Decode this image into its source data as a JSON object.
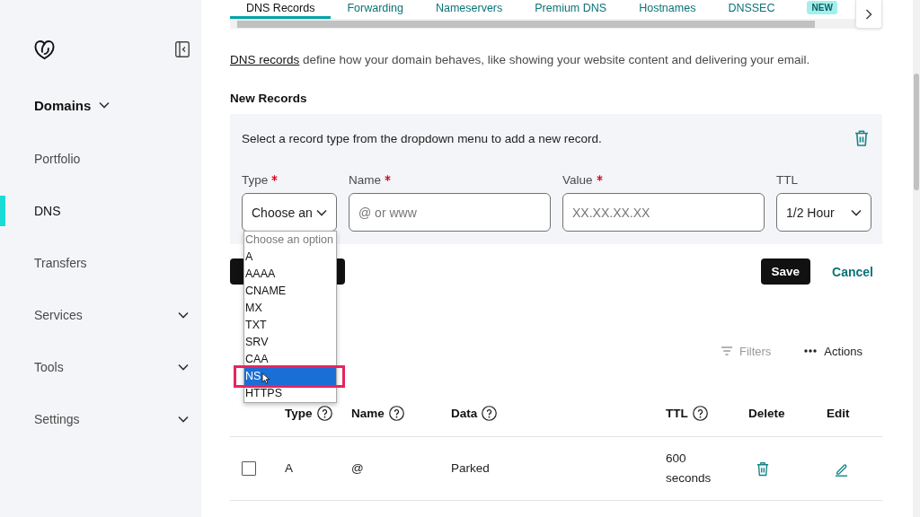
{
  "sidebar": {
    "section": {
      "label": "Domains"
    },
    "items": [
      {
        "label": "Portfolio",
        "kind": "link",
        "selected": false
      },
      {
        "label": "DNS",
        "kind": "link",
        "selected": true
      },
      {
        "label": "Transfers",
        "kind": "link",
        "selected": false
      },
      {
        "label": "Services",
        "kind": "group",
        "selected": false
      },
      {
        "label": "Tools",
        "kind": "group",
        "selected": false
      },
      {
        "label": "Settings",
        "kind": "group",
        "selected": false
      }
    ]
  },
  "tabs": [
    {
      "label": "DNS Records",
      "selected": true
    },
    {
      "label": "Forwarding",
      "selected": false
    },
    {
      "label": "Nameservers",
      "selected": false
    },
    {
      "label": "Premium DNS",
      "selected": false
    },
    {
      "label": "Hostnames",
      "selected": false
    },
    {
      "label": "DNSSEC",
      "selected": false
    },
    {
      "badge": "NEW",
      "selected": false
    }
  ],
  "intro": {
    "link": "DNS records",
    "text": "define how your domain behaves, like showing your website content and delivering your email."
  },
  "new_records": {
    "title": "New Records",
    "hint": "Select a record type from the dropdown menu to add a new record.",
    "fields": [
      {
        "kind": "select",
        "label": "Type",
        "required": true,
        "value": "Choose an",
        "menu": {
          "placeholder": "Choose an option",
          "options": [
            {
              "label": "A",
              "selected": false,
              "highlighted": false
            },
            {
              "label": "AAAA",
              "selected": false,
              "highlighted": false
            },
            {
              "label": "CNAME",
              "selected": false,
              "highlighted": false
            },
            {
              "label": "MX",
              "selected": false,
              "highlighted": false
            },
            {
              "label": "TXT",
              "selected": false,
              "highlighted": false
            },
            {
              "label": "SRV",
              "selected": false,
              "highlighted": false
            },
            {
              "label": "CAA",
              "selected": false,
              "highlighted": false
            },
            {
              "label": "NS",
              "selected": true,
              "highlighted": true
            },
            {
              "label": "HTTPS",
              "selected": false,
              "highlighted": false
            }
          ]
        }
      },
      {
        "kind": "input",
        "label": "Name",
        "required": true,
        "placeholder": "@ or www"
      },
      {
        "kind": "input",
        "label": "Value",
        "required": true,
        "placeholder": "XX.XX.XX.XX"
      },
      {
        "kind": "select",
        "label": "TTL",
        "required": false,
        "value": "1/2 Hour"
      }
    ],
    "buttons": [
      {
        "kind": "primary"
      },
      {
        "kind": "primary",
        "label": "Save"
      },
      {
        "kind": "link",
        "label": "Cancel"
      }
    ]
  },
  "toolbar": {
    "filters": {
      "label": "Filters",
      "disabled": true
    },
    "actions": {
      "label": "Actions"
    }
  },
  "table": {
    "columns": [
      {
        "label": "Type",
        "help": true,
        "kind": "text"
      },
      {
        "label": "Name",
        "help": true,
        "kind": "text"
      },
      {
        "label": "Data",
        "help": true,
        "kind": "text"
      },
      {
        "label": "TTL",
        "help": true,
        "kind": "text"
      },
      {
        "label": "Delete",
        "help": false,
        "kind": "delete"
      },
      {
        "label": "Edit",
        "help": false,
        "kind": "edit"
      }
    ],
    "rows": [
      {
        "checked": false,
        "cells": [
          "A",
          "@",
          "Parked",
          "600 seconds"
        ]
      }
    ]
  }
}
